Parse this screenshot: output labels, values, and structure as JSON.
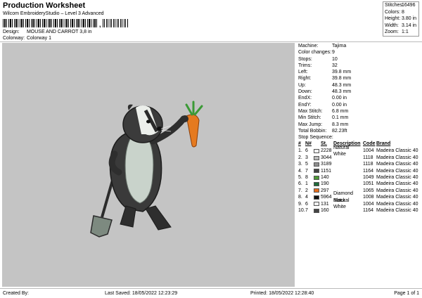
{
  "header": {
    "title": "Production Worksheet",
    "subtitle": "Wilcom EmbroideryStudio – Level 3 Advanced",
    "barcode_tail": ",",
    "design_label": "Design:",
    "design_value": "MOUSE AND CARROT 3,8 in",
    "colorway_label": "Colorway:",
    "colorway_value": "Colorway 1"
  },
  "stats": [
    {
      "k": "Stitches:",
      "v": "16496"
    },
    {
      "k": "Colors:",
      "v": "8"
    },
    {
      "k": "Height:",
      "v": "3.80 in"
    },
    {
      "k": "Width:",
      "v": "3.14 in"
    },
    {
      "k": "Zoom:",
      "v": "1:1"
    }
  ],
  "info": [
    {
      "k": "Machine:",
      "v": "Tajima"
    },
    {
      "k": "Color changes:",
      "v": "9"
    },
    {
      "k": "Stops:",
      "v": "10"
    },
    {
      "k": "Trims:",
      "v": "32"
    },
    {
      "k": "Left:",
      "v": "39.8 mm"
    },
    {
      "k": "Right:",
      "v": "39.8 mm"
    },
    {
      "k": "Up:",
      "v": "48.3 mm"
    },
    {
      "k": "Down:",
      "v": "48.3 mm"
    },
    {
      "k": "EndX:",
      "v": "0.00 in"
    },
    {
      "k": "EndY:",
      "v": "0.00 in"
    },
    {
      "k": "Max Stitch:",
      "v": "6.8 mm"
    },
    {
      "k": "Min Stitch:",
      "v": "0.1 mm"
    },
    {
      "k": "Max Jump:",
      "v": "8.3 mm"
    },
    {
      "k": "Total Bobbin:",
      "v": "82.23ft"
    }
  ],
  "stop_sequence": {
    "title": "Stop Sequence:",
    "headers": {
      "num": "#",
      "n": "N#",
      "st": "St.",
      "desc": "Description",
      "code": "Code",
      "brand": "Brand"
    },
    "rows": [
      {
        "num": "1.",
        "n": "6",
        "color": "#f0f0f0",
        "st": "2228",
        "desc": "Natural White",
        "code": "1004",
        "brand": "Madeira Classic 40"
      },
      {
        "num": "2.",
        "n": "3",
        "color": "#b9b9b9",
        "st": "3044",
        "desc": "",
        "code": "1118",
        "brand": "Madeira Classic 40"
      },
      {
        "num": "3.",
        "n": "5",
        "color": "#8f8f8f",
        "st": "3189",
        "desc": "",
        "code": "1118",
        "brand": "Madeira Classic 40"
      },
      {
        "num": "4.",
        "n": "7",
        "color": "#444444",
        "st": "1151",
        "desc": "",
        "code": "1164",
        "brand": "Madeira Classic 40"
      },
      {
        "num": "5.",
        "n": "8",
        "color": "#4d9a36",
        "st": "140",
        "desc": "",
        "code": "1049",
        "brand": "Madeira Classic 40"
      },
      {
        "num": "6.",
        "n": "1",
        "color": "#1f6b3a",
        "st": "190",
        "desc": "",
        "code": "1051",
        "brand": "Madeira Classic 40"
      },
      {
        "num": "7.",
        "n": "2",
        "color": "#e36c1c",
        "st": "297",
        "desc": "",
        "code": "1065",
        "brand": "Madeira Classic 40"
      },
      {
        "num": "8.",
        "n": "4",
        "color": "#111111",
        "st": "5964",
        "desc": "Diamond Black",
        "code": "1008",
        "brand": "Madeira Classic 40"
      },
      {
        "num": "9.",
        "n": "6",
        "color": "#f0f0f0",
        "st": "131",
        "desc": "Natural White",
        "code": "1004",
        "brand": "Madeira Classic 40"
      },
      {
        "num": "10.",
        "n": "7",
        "color": "#444444",
        "st": "160",
        "desc": "",
        "code": "1164",
        "brand": "Madeira Classic 40"
      }
    ]
  },
  "footer": {
    "created": "Created By:",
    "saved": "Last Saved: 18/05/2022 12:23:29",
    "printed": "Printed: 18/05/2022 12:28:40",
    "page": "Page 1 of 1"
  }
}
